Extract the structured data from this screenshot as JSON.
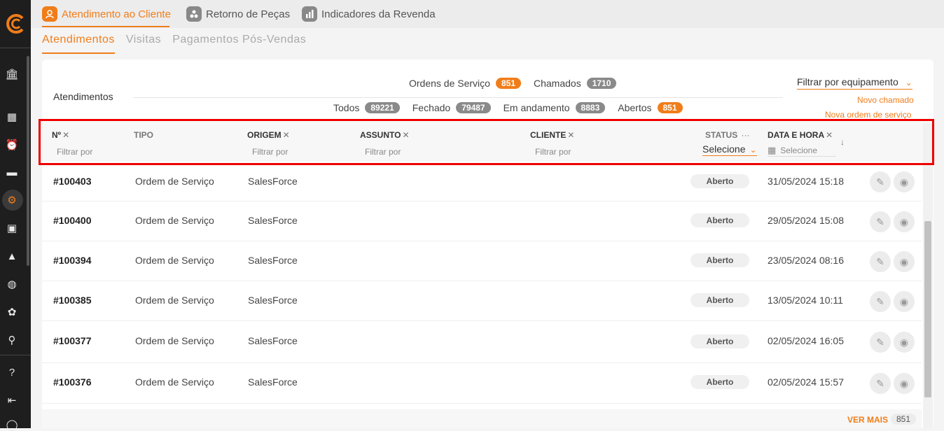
{
  "colors": {
    "accent": "#f07d1a",
    "sidebar": "#1e1e1e",
    "highlight": "#e00000"
  },
  "sidebar": {
    "items": [
      {
        "icon": "dashboard-icon"
      },
      {
        "icon": "grid-icon"
      },
      {
        "icon": "alarm-icon"
      },
      {
        "icon": "chat-icon"
      },
      {
        "icon": "service-gear-icon"
      },
      {
        "icon": "calendar-icon"
      },
      {
        "icon": "warning-icon"
      },
      {
        "icon": "globe-icon"
      },
      {
        "icon": "plant-icon"
      },
      {
        "icon": "location-icon"
      },
      {
        "icon": "help-icon"
      },
      {
        "icon": "logout-icon"
      },
      {
        "icon": "user-icon"
      }
    ]
  },
  "top_tabs": [
    {
      "label": "Atendimento ao Cliente",
      "active": true
    },
    {
      "label": "Retorno de Peças",
      "active": false
    },
    {
      "label": "Indicadores da Revenda",
      "active": false
    }
  ],
  "sub_tabs": [
    {
      "label": "Atendimentos",
      "active": true
    },
    {
      "label": "Visitas",
      "active": false
    },
    {
      "label": "Pagamentos Pós-Vendas",
      "active": false
    }
  ],
  "panel": {
    "title": "Atendimentos",
    "ordens_label": "Ordens de Serviço",
    "ordens_count": "851",
    "chamados_label": "Chamados",
    "chamados_count": "1710",
    "todos_label": "Todos",
    "todos_count": "89221",
    "fechado_label": "Fechado",
    "fechado_count": "79487",
    "andamento_label": "Em andamento",
    "andamento_count": "8883",
    "abertos_label": "Abertos",
    "abertos_count": "851",
    "filter_equipment": "Filtrar por equipamento",
    "novo_chamado": "Novo chamado",
    "nova_ordem": "Nova ordem de serviço"
  },
  "table": {
    "headers": {
      "numero": "Nº",
      "tipo": "TIPO",
      "origem": "ORIGEM",
      "assunto": "ASSUNTO",
      "cliente": "CLIENTE",
      "status": "STATUS",
      "data_hora": "DATA E HORA"
    },
    "filter_placeholder": "Filtrar por",
    "status_select": "Selecione",
    "date_select": "Selecione",
    "rows": [
      {
        "id": "#100403",
        "tipo": "Ordem de Serviço",
        "origem": "SalesForce",
        "status": "Aberto",
        "data": "31/05/2024 15:18"
      },
      {
        "id": "#100400",
        "tipo": "Ordem de Serviço",
        "origem": "SalesForce",
        "status": "Aberto",
        "data": "29/05/2024 15:08"
      },
      {
        "id": "#100394",
        "tipo": "Ordem de Serviço",
        "origem": "SalesForce",
        "status": "Aberto",
        "data": "23/05/2024 08:16"
      },
      {
        "id": "#100385",
        "tipo": "Ordem de Serviço",
        "origem": "SalesForce",
        "status": "Aberto",
        "data": "13/05/2024 10:11"
      },
      {
        "id": "#100377",
        "tipo": "Ordem de Serviço",
        "origem": "SalesForce",
        "status": "Aberto",
        "data": "02/05/2024 16:05"
      },
      {
        "id": "#100376",
        "tipo": "Ordem de Serviço",
        "origem": "SalesForce",
        "status": "Aberto",
        "data": "02/05/2024 15:57"
      }
    ]
  },
  "footer": {
    "ver_mais": "VER MAIS",
    "count": "851"
  }
}
